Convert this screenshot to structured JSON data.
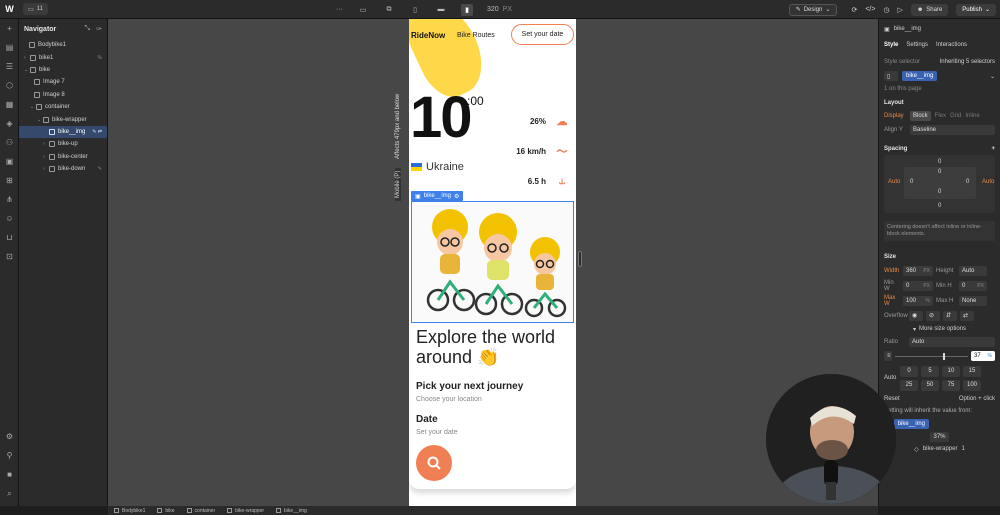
{
  "topbar": {
    "logo": "W",
    "page_pill": "11",
    "more": "···",
    "width_value": "320",
    "width_unit": "PX",
    "design_label": "Design",
    "share_label": "Share",
    "publish_label": "Publish"
  },
  "navigator": {
    "title": "Navigator",
    "items": [
      {
        "label": "Bodybike1",
        "badge": ""
      },
      {
        "label": "bike1",
        "badge": "%"
      },
      {
        "label": "bike",
        "badge": ""
      },
      {
        "label": "Image 7",
        "badge": ""
      },
      {
        "label": "Image 8",
        "badge": ""
      },
      {
        "label": "container",
        "badge": ""
      },
      {
        "label": "bike-wrapper",
        "badge": ""
      },
      {
        "label": "bike__img",
        "badge": "✎ ⇄"
      },
      {
        "label": "bike-up",
        "badge": ""
      },
      {
        "label": "bike-center",
        "badge": ""
      },
      {
        "label": "bike-down",
        "badge": "✎"
      }
    ]
  },
  "canvas": {
    "affects_label": "Affects 479px and below",
    "mobile_label": "Mobile (P)",
    "site": {
      "brand": "RideNow",
      "routes": "Bike Routes",
      "date_pill": "Set your date",
      "time_big": "10",
      "time_sup": ":00",
      "stats": [
        {
          "value": "26%",
          "icon": "cloud-icon"
        },
        {
          "value": "16 km/h",
          "icon": "wind-icon"
        },
        {
          "value": "6.5 h",
          "icon": "route-icon"
        }
      ],
      "country": "Ukraine",
      "img_label": "bike__img",
      "explore": "Explore the world around",
      "wave": "👏",
      "journey_title": "Pick your next journey",
      "journey_sub": "Choose your location",
      "date_title": "Date",
      "date_sub": "Set your date"
    }
  },
  "right_panel": {
    "element_name": "bike__img",
    "tabs": [
      "Style",
      "Settings",
      "Interactions"
    ],
    "style_selector_label": "Style selector",
    "inheriting_label": "Inheriting 5 selectors",
    "selector_chip": "bike__img",
    "on_page": "1 on this page",
    "layout_title": "Layout",
    "display_label": "Display",
    "display_options": [
      "Block",
      "Flex",
      "Grid",
      "Inline"
    ],
    "align_label": "Align Y",
    "align_value": "Baseline",
    "spacing_title": "Spacing",
    "margin_values": {
      "top": "0",
      "inner_top": "0",
      "left": "Auto",
      "right": "Auto",
      "inner_left": "0",
      "inner_right": "0",
      "inner_bottom": "0",
      "bottom": "0"
    },
    "spacing_note": "Centering doesn't affect inline or inline-block elements.",
    "size_title": "Size",
    "width_label": "Width",
    "width_value": "360",
    "width_unit": "PX",
    "height_label": "Height",
    "height_value": "Auto",
    "minw_label": "Min W",
    "minw_value": "0",
    "minw_unit": "PX",
    "minh_label": "Min H",
    "minh_value": "0",
    "minh_unit": "PX",
    "maxw_label": "Max W",
    "maxw_value": "100",
    "maxw_unit": "%",
    "maxh_label": "Max H",
    "maxh_value": "None",
    "overflow_label": "Overflow",
    "more_size": "More size options",
    "ratio_label": "Ratio",
    "ratio_value": "Auto",
    "slider_value": "37",
    "slider_unit": "%",
    "auto_label": "Auto",
    "percent_options": [
      "0",
      "5",
      "10",
      "15",
      "25",
      "50",
      "75",
      "100"
    ],
    "reset_label": "Reset",
    "option_click": "Option + click",
    "inherit_note": "Setting will inherit the value from:",
    "inherit_chip": "bike__img",
    "percent_badge": "37%",
    "wrapper_label": "bike-wrapper",
    "wrapper_count": "1"
  },
  "statusbar": {
    "crumbs": [
      "Bodybike1",
      "bike",
      "container",
      "bike-wrapper",
      "bike__img"
    ]
  },
  "colors": {
    "accent": "#f07f53",
    "selection": "#3f80ea",
    "yellow": "#ffd84a"
  }
}
